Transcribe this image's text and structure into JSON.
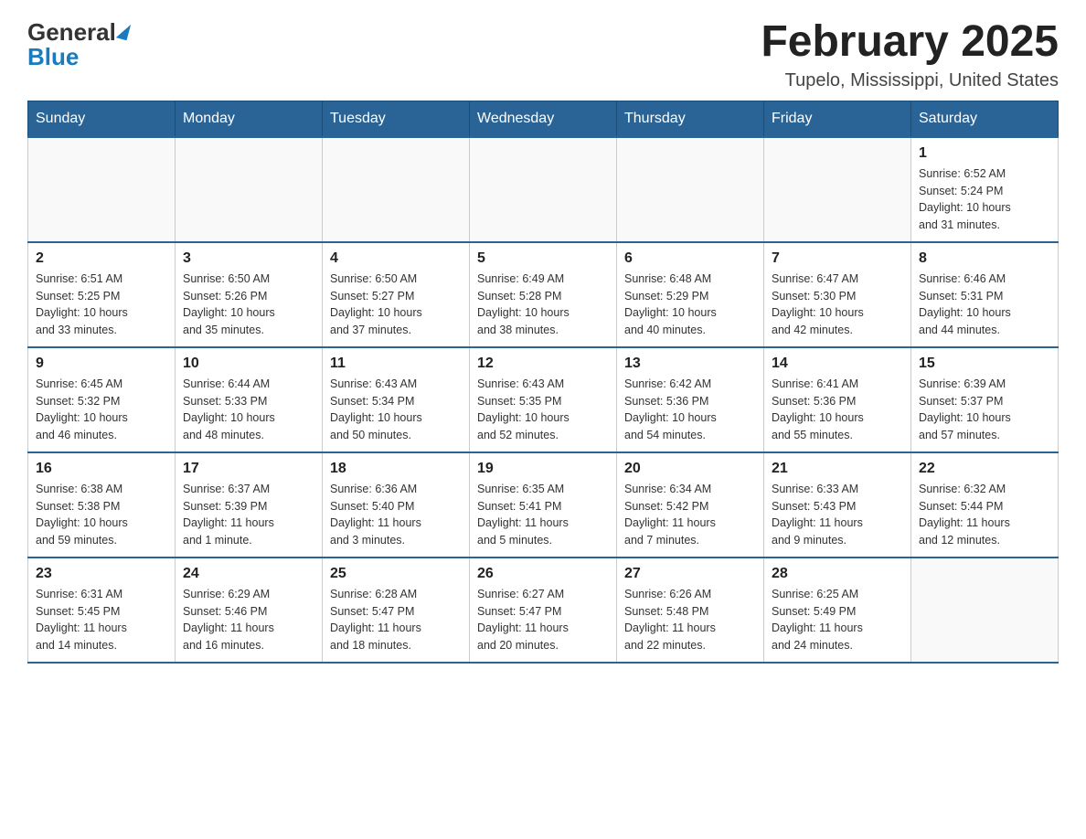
{
  "header": {
    "logo_general": "General",
    "logo_blue": "Blue",
    "month_title": "February 2025",
    "location": "Tupelo, Mississippi, United States"
  },
  "days_of_week": [
    "Sunday",
    "Monday",
    "Tuesday",
    "Wednesday",
    "Thursday",
    "Friday",
    "Saturday"
  ],
  "weeks": [
    [
      {
        "day": "",
        "info": ""
      },
      {
        "day": "",
        "info": ""
      },
      {
        "day": "",
        "info": ""
      },
      {
        "day": "",
        "info": ""
      },
      {
        "day": "",
        "info": ""
      },
      {
        "day": "",
        "info": ""
      },
      {
        "day": "1",
        "info": "Sunrise: 6:52 AM\nSunset: 5:24 PM\nDaylight: 10 hours\nand 31 minutes."
      }
    ],
    [
      {
        "day": "2",
        "info": "Sunrise: 6:51 AM\nSunset: 5:25 PM\nDaylight: 10 hours\nand 33 minutes."
      },
      {
        "day": "3",
        "info": "Sunrise: 6:50 AM\nSunset: 5:26 PM\nDaylight: 10 hours\nand 35 minutes."
      },
      {
        "day": "4",
        "info": "Sunrise: 6:50 AM\nSunset: 5:27 PM\nDaylight: 10 hours\nand 37 minutes."
      },
      {
        "day": "5",
        "info": "Sunrise: 6:49 AM\nSunset: 5:28 PM\nDaylight: 10 hours\nand 38 minutes."
      },
      {
        "day": "6",
        "info": "Sunrise: 6:48 AM\nSunset: 5:29 PM\nDaylight: 10 hours\nand 40 minutes."
      },
      {
        "day": "7",
        "info": "Sunrise: 6:47 AM\nSunset: 5:30 PM\nDaylight: 10 hours\nand 42 minutes."
      },
      {
        "day": "8",
        "info": "Sunrise: 6:46 AM\nSunset: 5:31 PM\nDaylight: 10 hours\nand 44 minutes."
      }
    ],
    [
      {
        "day": "9",
        "info": "Sunrise: 6:45 AM\nSunset: 5:32 PM\nDaylight: 10 hours\nand 46 minutes."
      },
      {
        "day": "10",
        "info": "Sunrise: 6:44 AM\nSunset: 5:33 PM\nDaylight: 10 hours\nand 48 minutes."
      },
      {
        "day": "11",
        "info": "Sunrise: 6:43 AM\nSunset: 5:34 PM\nDaylight: 10 hours\nand 50 minutes."
      },
      {
        "day": "12",
        "info": "Sunrise: 6:43 AM\nSunset: 5:35 PM\nDaylight: 10 hours\nand 52 minutes."
      },
      {
        "day": "13",
        "info": "Sunrise: 6:42 AM\nSunset: 5:36 PM\nDaylight: 10 hours\nand 54 minutes."
      },
      {
        "day": "14",
        "info": "Sunrise: 6:41 AM\nSunset: 5:36 PM\nDaylight: 10 hours\nand 55 minutes."
      },
      {
        "day": "15",
        "info": "Sunrise: 6:39 AM\nSunset: 5:37 PM\nDaylight: 10 hours\nand 57 minutes."
      }
    ],
    [
      {
        "day": "16",
        "info": "Sunrise: 6:38 AM\nSunset: 5:38 PM\nDaylight: 10 hours\nand 59 minutes."
      },
      {
        "day": "17",
        "info": "Sunrise: 6:37 AM\nSunset: 5:39 PM\nDaylight: 11 hours\nand 1 minute."
      },
      {
        "day": "18",
        "info": "Sunrise: 6:36 AM\nSunset: 5:40 PM\nDaylight: 11 hours\nand 3 minutes."
      },
      {
        "day": "19",
        "info": "Sunrise: 6:35 AM\nSunset: 5:41 PM\nDaylight: 11 hours\nand 5 minutes."
      },
      {
        "day": "20",
        "info": "Sunrise: 6:34 AM\nSunset: 5:42 PM\nDaylight: 11 hours\nand 7 minutes."
      },
      {
        "day": "21",
        "info": "Sunrise: 6:33 AM\nSunset: 5:43 PM\nDaylight: 11 hours\nand 9 minutes."
      },
      {
        "day": "22",
        "info": "Sunrise: 6:32 AM\nSunset: 5:44 PM\nDaylight: 11 hours\nand 12 minutes."
      }
    ],
    [
      {
        "day": "23",
        "info": "Sunrise: 6:31 AM\nSunset: 5:45 PM\nDaylight: 11 hours\nand 14 minutes."
      },
      {
        "day": "24",
        "info": "Sunrise: 6:29 AM\nSunset: 5:46 PM\nDaylight: 11 hours\nand 16 minutes."
      },
      {
        "day": "25",
        "info": "Sunrise: 6:28 AM\nSunset: 5:47 PM\nDaylight: 11 hours\nand 18 minutes."
      },
      {
        "day": "26",
        "info": "Sunrise: 6:27 AM\nSunset: 5:47 PM\nDaylight: 11 hours\nand 20 minutes."
      },
      {
        "day": "27",
        "info": "Sunrise: 6:26 AM\nSunset: 5:48 PM\nDaylight: 11 hours\nand 22 minutes."
      },
      {
        "day": "28",
        "info": "Sunrise: 6:25 AM\nSunset: 5:49 PM\nDaylight: 11 hours\nand 24 minutes."
      },
      {
        "day": "",
        "info": ""
      }
    ]
  ]
}
